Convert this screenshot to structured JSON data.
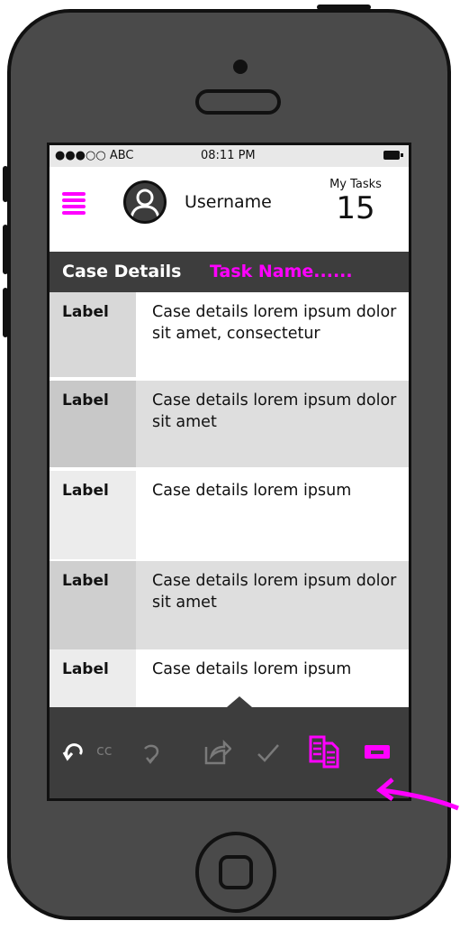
{
  "status_bar": {
    "carrier": "●●●○○ ABC",
    "time": "08:11 PM"
  },
  "header": {
    "username": "Username",
    "tasks_label": "My Tasks",
    "tasks_count": "15"
  },
  "title_bar": {
    "title": "Case Details",
    "task_name": "Task Name......"
  },
  "rows": [
    {
      "label": "Label",
      "value": "Case details lorem ipsum dolor sit amet, consectetur"
    },
    {
      "label": "Label",
      "value": "Case details lorem ipsum dolor sit amet"
    },
    {
      "label": "Label",
      "value": "Case details lorem ipsum"
    },
    {
      "label": "Label",
      "value": "Case details lorem ipsum dolor sit amet"
    },
    {
      "label": "Label",
      "value": "Case details lorem ipsum"
    }
  ],
  "toolbar": {
    "icons": [
      "undo-icon",
      "cc-icon",
      "redo-icon",
      "share-icon",
      "check-icon",
      "copy-document-icon",
      "battery-shape-icon"
    ],
    "cc_text": "cc"
  },
  "colors": {
    "accent": "#ff00ff",
    "dark_bar": "#3d3d3d",
    "phone": "#4a4a4a"
  }
}
